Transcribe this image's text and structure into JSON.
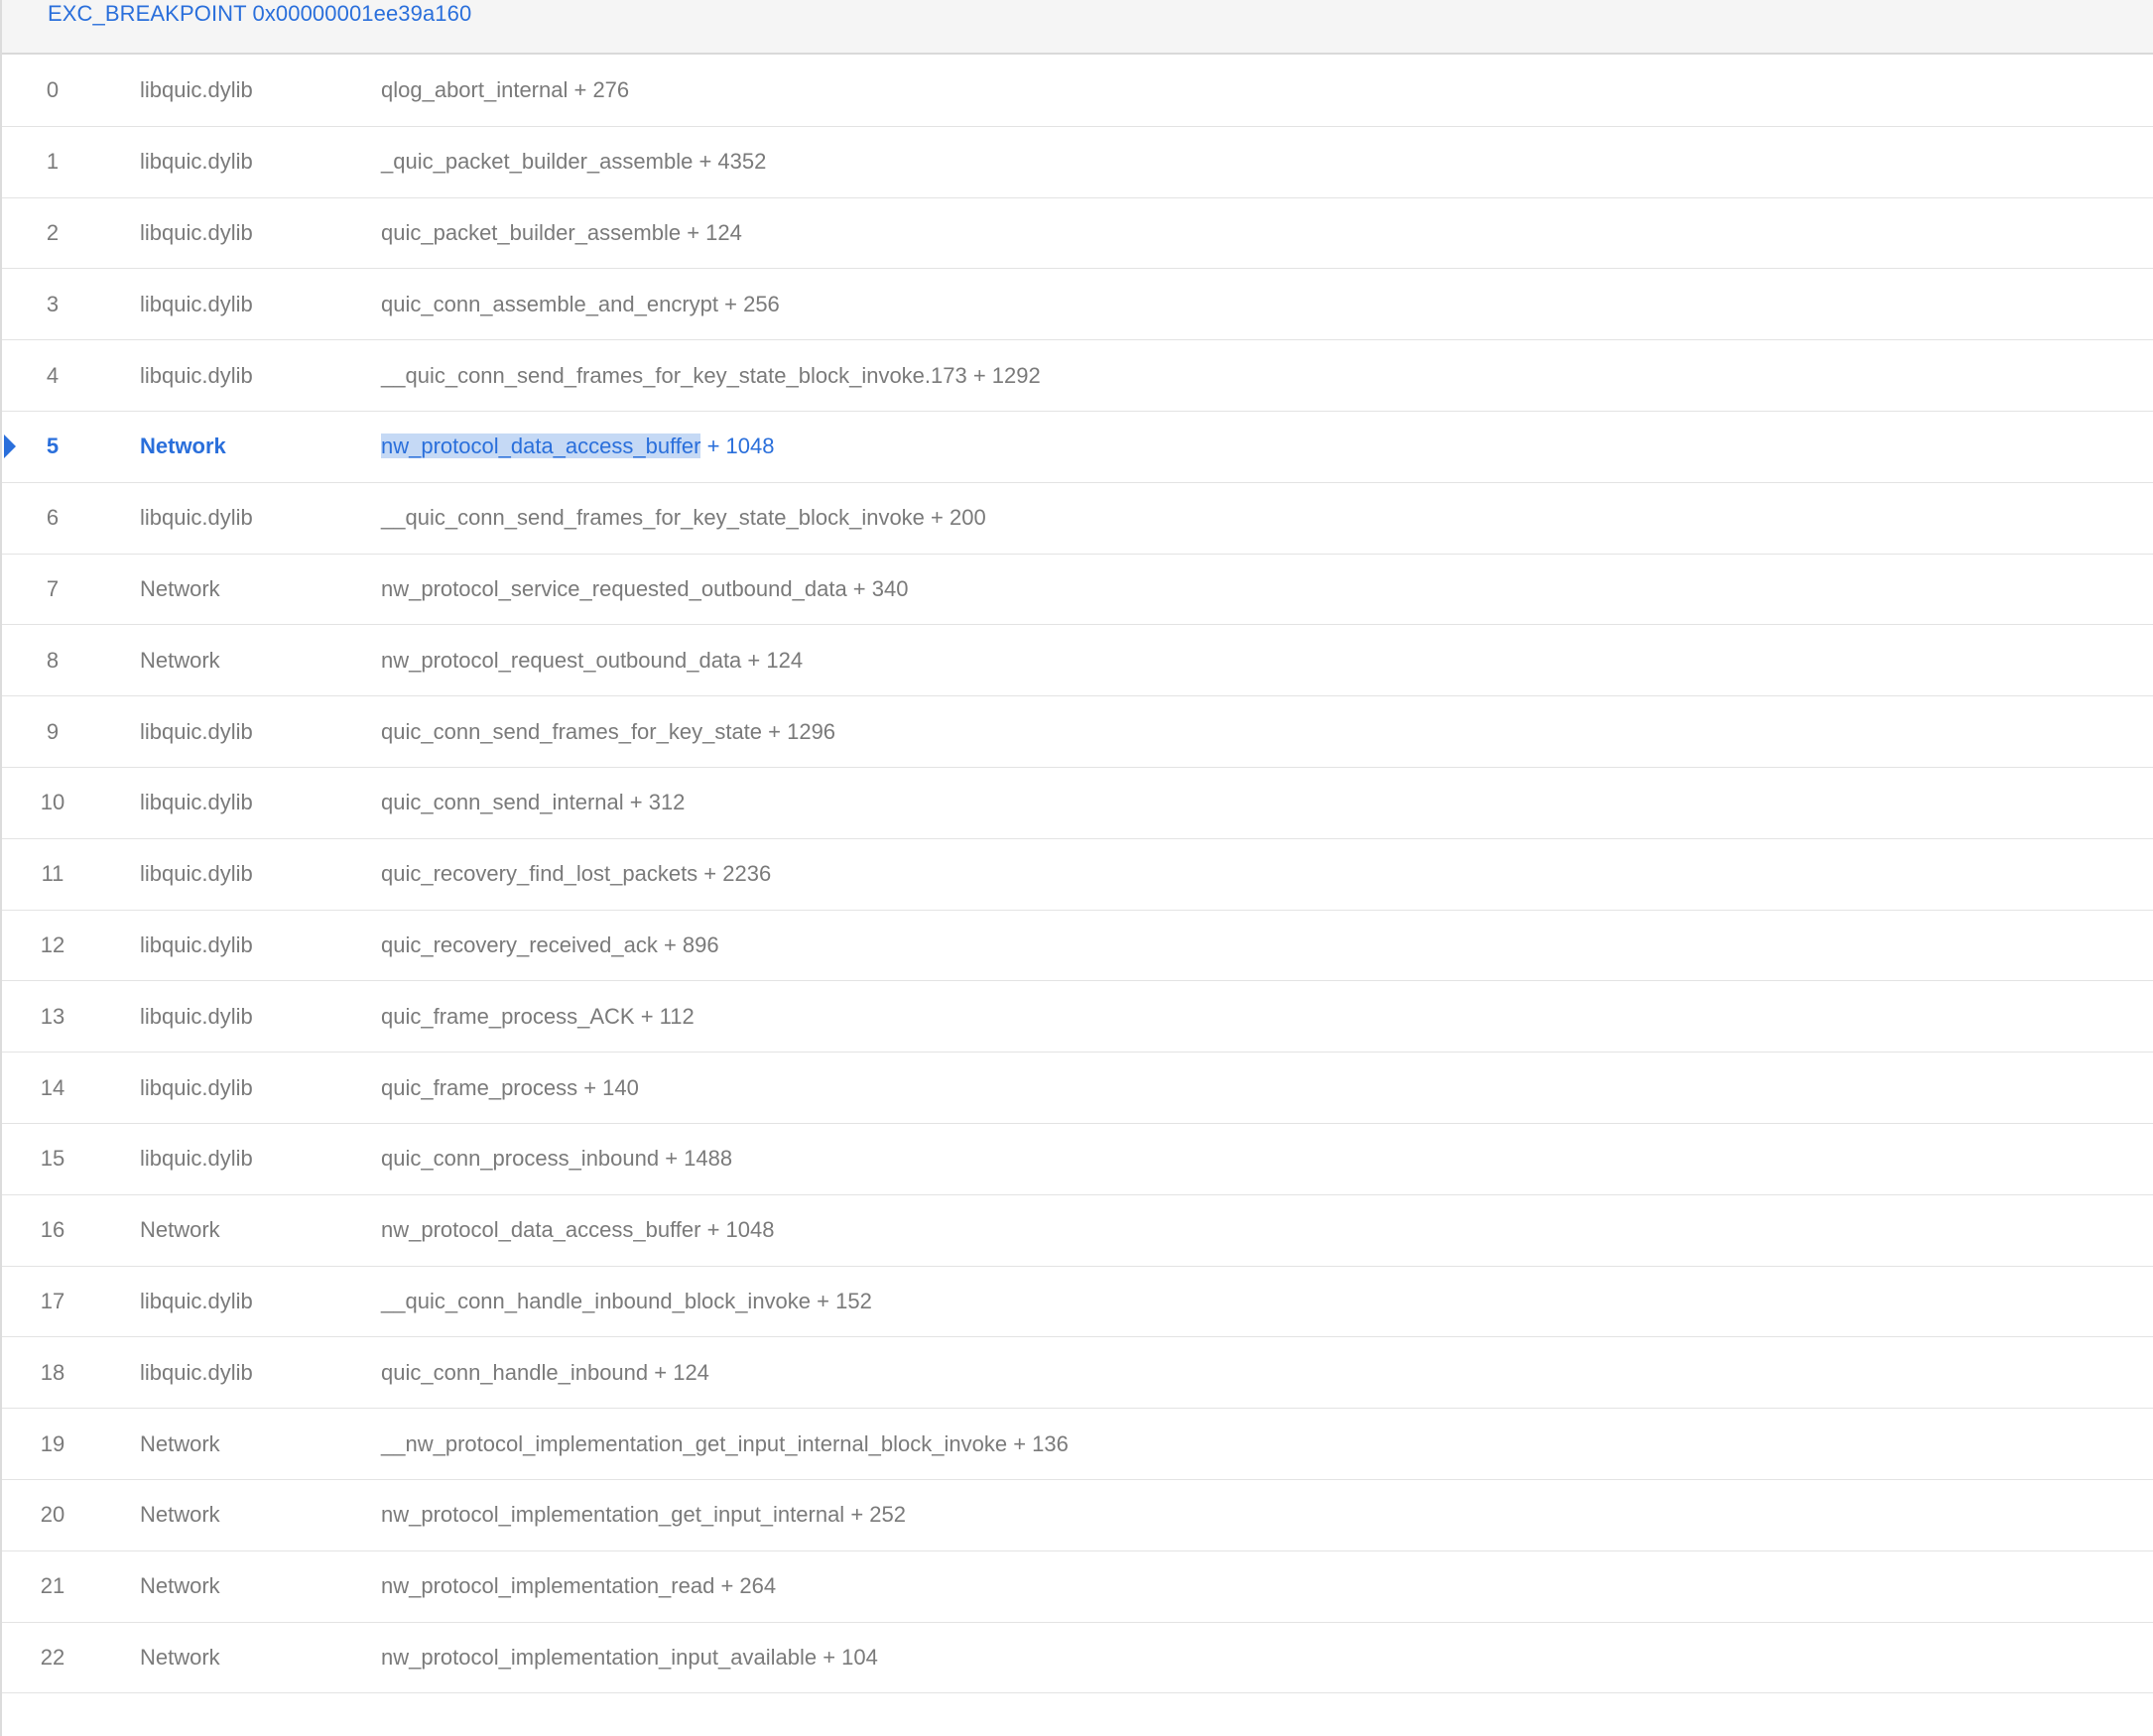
{
  "header": {
    "title": "EXC_BREAKPOINT 0x00000001ee39a160"
  },
  "selected_index": 5,
  "colors": {
    "accent": "#2a6fdb",
    "selection_highlight": "#c5d9f5",
    "text_muted": "#7a7a7a",
    "header_bg": "#f5f5f5",
    "divider": "#e3e3e3"
  },
  "frames": [
    {
      "index": "0",
      "library": "libquic.dylib",
      "function": "qlog_abort_internal",
      "offset": " + 276"
    },
    {
      "index": "1",
      "library": "libquic.dylib",
      "function": "_quic_packet_builder_assemble",
      "offset": " + 4352"
    },
    {
      "index": "2",
      "library": "libquic.dylib",
      "function": "quic_packet_builder_assemble",
      "offset": " + 124"
    },
    {
      "index": "3",
      "library": "libquic.dylib",
      "function": "quic_conn_assemble_and_encrypt",
      "offset": " + 256"
    },
    {
      "index": "4",
      "library": "libquic.dylib",
      "function": "__quic_conn_send_frames_for_key_state_block_invoke.173",
      "offset": " + 1292"
    },
    {
      "index": "5",
      "library": "Network",
      "function": "nw_protocol_data_access_buffer",
      "offset": " + 1048"
    },
    {
      "index": "6",
      "library": "libquic.dylib",
      "function": "__quic_conn_send_frames_for_key_state_block_invoke",
      "offset": " + 200"
    },
    {
      "index": "7",
      "library": "Network",
      "function": "nw_protocol_service_requested_outbound_data",
      "offset": " + 340"
    },
    {
      "index": "8",
      "library": "Network",
      "function": "nw_protocol_request_outbound_data",
      "offset": " + 124"
    },
    {
      "index": "9",
      "library": "libquic.dylib",
      "function": "quic_conn_send_frames_for_key_state",
      "offset": " + 1296"
    },
    {
      "index": "10",
      "library": "libquic.dylib",
      "function": "quic_conn_send_internal",
      "offset": " + 312"
    },
    {
      "index": "11",
      "library": "libquic.dylib",
      "function": "quic_recovery_find_lost_packets",
      "offset": " + 2236"
    },
    {
      "index": "12",
      "library": "libquic.dylib",
      "function": "quic_recovery_received_ack",
      "offset": " + 896"
    },
    {
      "index": "13",
      "library": "libquic.dylib",
      "function": "quic_frame_process_ACK",
      "offset": " + 112"
    },
    {
      "index": "14",
      "library": "libquic.dylib",
      "function": "quic_frame_process",
      "offset": " + 140"
    },
    {
      "index": "15",
      "library": "libquic.dylib",
      "function": "quic_conn_process_inbound",
      "offset": " + 1488"
    },
    {
      "index": "16",
      "library": "Network",
      "function": "nw_protocol_data_access_buffer",
      "offset": " + 1048"
    },
    {
      "index": "17",
      "library": "libquic.dylib",
      "function": "__quic_conn_handle_inbound_block_invoke",
      "offset": " + 152"
    },
    {
      "index": "18",
      "library": "libquic.dylib",
      "function": "quic_conn_handle_inbound",
      "offset": " + 124"
    },
    {
      "index": "19",
      "library": "Network",
      "function": "__nw_protocol_implementation_get_input_internal_block_invoke",
      "offset": " + 136"
    },
    {
      "index": "20",
      "library": "Network",
      "function": "nw_protocol_implementation_get_input_internal",
      "offset": " + 252"
    },
    {
      "index": "21",
      "library": "Network",
      "function": "nw_protocol_implementation_read",
      "offset": " + 264"
    },
    {
      "index": "22",
      "library": "Network",
      "function": "nw_protocol_implementation_input_available",
      "offset": " + 104"
    }
  ]
}
